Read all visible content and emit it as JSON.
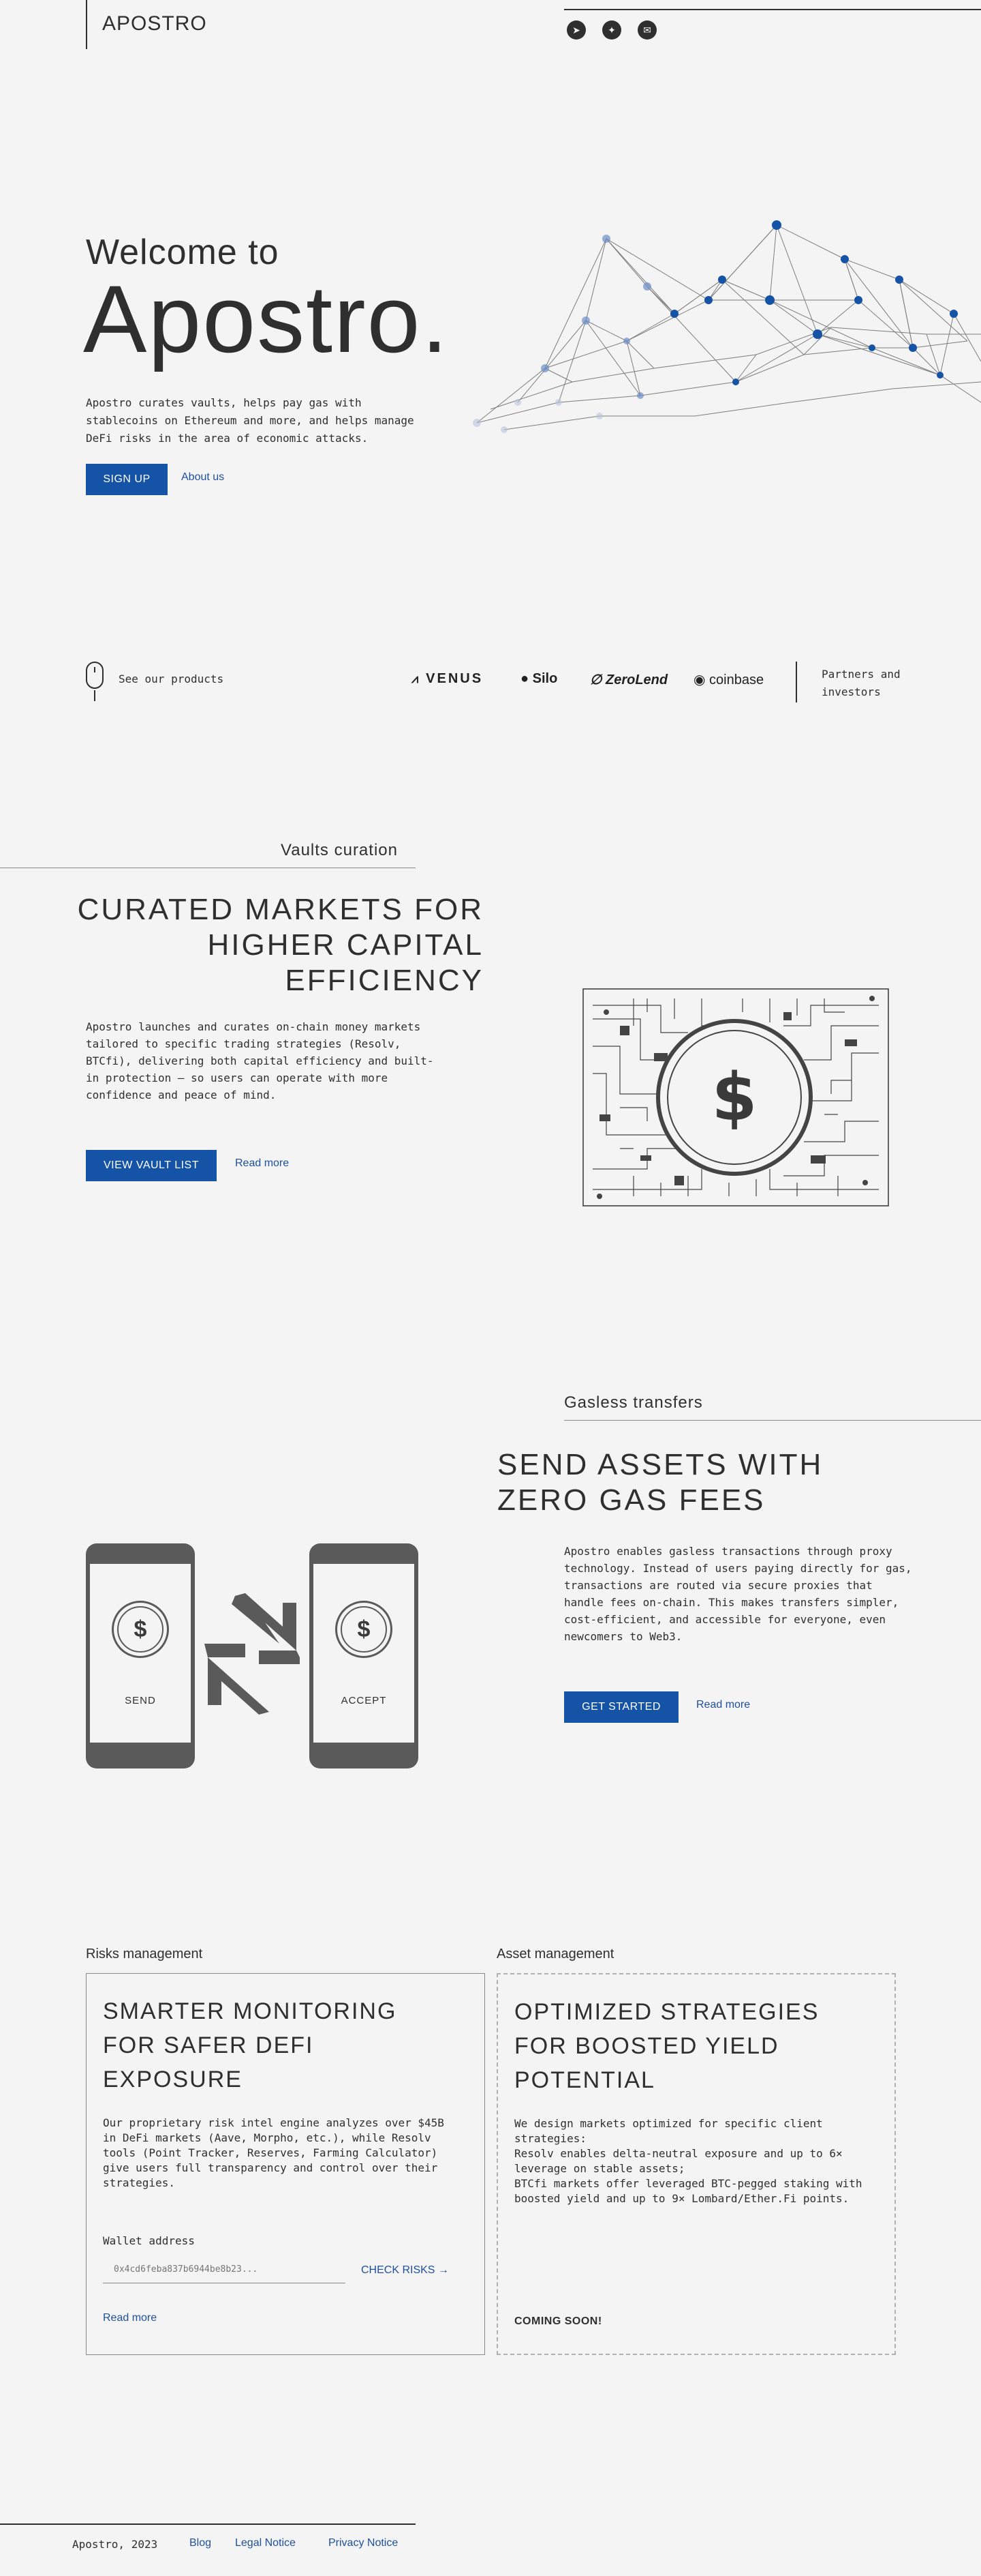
{
  "header": {
    "logo": "APOSTRO",
    "social": [
      {
        "name": "telegram-icon",
        "glyph": "➤"
      },
      {
        "name": "twitter-icon",
        "glyph": "✦"
      },
      {
        "name": "email-icon",
        "glyph": "✉"
      }
    ]
  },
  "hero": {
    "welcome": "Welcome to",
    "brand": "Apostro.",
    "description": "Apostro curates vaults, helps pay gas with stablecoins on Ethereum and more, and helps manage DeFi risks in the area of economic attacks.",
    "signup_label": "SIGN UP",
    "about_label": "About us"
  },
  "partners": {
    "products_label": "See our products",
    "logos": [
      "VENUS",
      "Silo",
      "ZeroLend",
      "coinbase"
    ],
    "caption": "Partners and investors"
  },
  "vaults": {
    "section_label": "Vaults curation",
    "title_lines": [
      "CURATED MARKETS FOR",
      "HIGHER CAPITAL",
      "EFFICIENCY"
    ],
    "description": "Apostro launches and curates on-chain money markets tailored to specific trading strategies (Resolv, BTCfi), delivering both capital efficiency and built-in protection — so users can operate with more confidence and peace of mind.",
    "cta_label": "VIEW VAULT LIST",
    "read_more": "Read more",
    "coin_symbol": "$"
  },
  "gasless": {
    "section_label": "Gasless transfers",
    "title_lines": [
      "SEND ASSETS WITH",
      "ZERO GAS FEES"
    ],
    "description": "Apostro enables gasless transactions through proxy technology. Instead of users paying directly for gas, transactions are routed via secure proxies that handle fees on-chain. This makes transfers simpler, cost-efficient, and accessible for everyone, even newcomers to Web3.",
    "cta_label": "GET STARTED",
    "read_more": "Read more",
    "send_label": "SEND",
    "accept_label": "ACCEPT",
    "coin_symbol": "$"
  },
  "risks": {
    "section_label": "Risks management",
    "title_lines": [
      "SMARTER MONITORING",
      "FOR SAFER DEFI",
      "EXPOSURE"
    ],
    "description": "Our proprietary risk intel engine analyzes over $45B in DeFi markets (Aave, Morpho, etc.), while Resolv tools (Point Tracker, Reserves, Farming Calculator) give users full transparency and control over their strategies.",
    "wallet_label": "Wallet address",
    "wallet_placeholder": "0x4cd6feba837b6944be8b23...",
    "check_label": "CHECK RISKS",
    "read_more": "Read more"
  },
  "assets": {
    "section_label": "Asset management",
    "title_lines": [
      "OPTIMIZED STRATEGIES",
      "FOR BOOSTED YIELD",
      "POTENTIAL"
    ],
    "description_lines": [
      "We design markets optimized for specific client strategies:",
      "Resolv enables delta-neutral exposure and up to 6× leverage on stable assets;",
      "BTCfi markets offer leveraged BTC-pegged staking with boosted yield and up to 9× Lombard/Ether.Fi points."
    ],
    "status": "COMING SOON!"
  },
  "footer": {
    "copyright": "Apostro, 2023",
    "links": [
      "Blog",
      "Legal Notice",
      "Privacy Notice"
    ]
  },
  "colors": {
    "accent": "#1553a6",
    "text": "#2f2f2f",
    "background": "#f4f4f4"
  }
}
